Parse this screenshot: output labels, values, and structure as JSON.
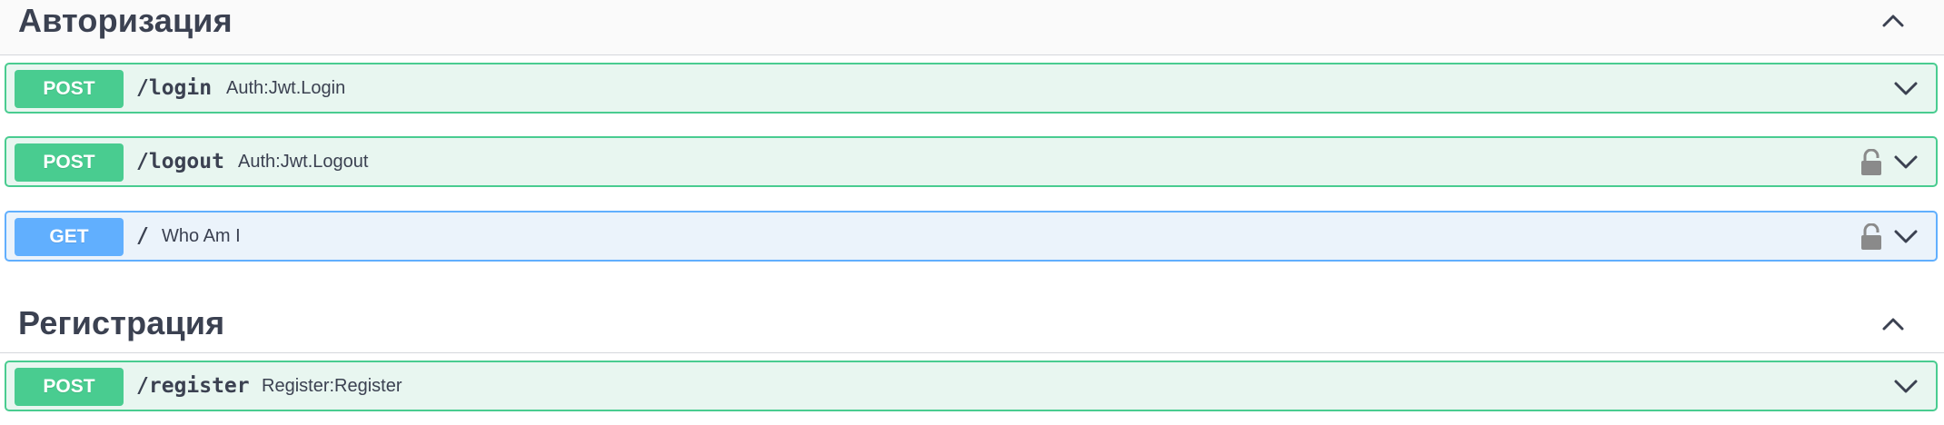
{
  "sections": [
    {
      "title": "Авторизация",
      "operations": [
        {
          "method": "POST",
          "path": "/login",
          "summary": "Auth:Jwt.Login",
          "locked": false
        },
        {
          "method": "POST",
          "path": "/logout",
          "summary": "Auth:Jwt.Logout",
          "locked": true
        },
        {
          "method": "GET",
          "path": "/",
          "summary": "Who Am I",
          "locked": true
        }
      ]
    },
    {
      "title": "Регистрация",
      "operations": [
        {
          "method": "POST",
          "path": "/register",
          "summary": "Register:Register",
          "locked": false
        }
      ]
    }
  ],
  "icons": {
    "section_toggle": "chevron-up-icon",
    "operation_toggle": "chevron-down-icon",
    "auth": "lock-icon"
  },
  "colors": {
    "post": "#49cc90",
    "post_bg": "#e8f6f0",
    "get": "#61affe",
    "get_bg": "#ebf3fb",
    "text": "#3b4151",
    "lock": "#8a8a8a"
  }
}
